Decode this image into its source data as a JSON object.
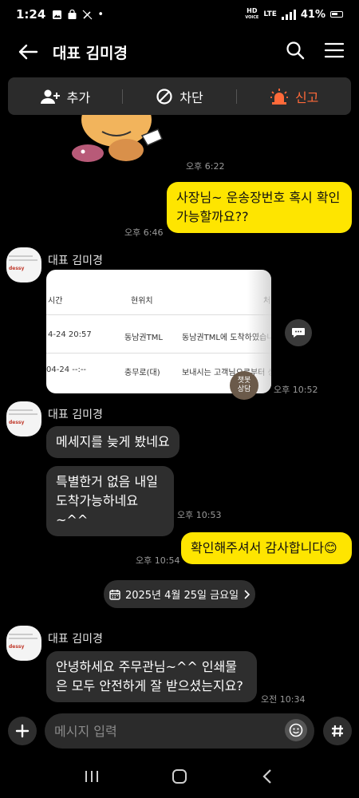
{
  "status_bar": {
    "time": "1:24",
    "network": "LTE",
    "hd_label": "HD",
    "voice_label": "VOICE",
    "battery": "41%"
  },
  "header": {
    "title": "대표 김미경"
  },
  "actions": {
    "add": "추가",
    "block": "차단",
    "report": "신고"
  },
  "messages": {
    "sticker_time": "오후 6:22",
    "msg1": "사장님~ 운송장번호 혹시 확인 가능할까요??",
    "msg1_time": "오후 6:46",
    "sender1": "대표 김미경",
    "image_time": "오후 10:52",
    "image_table": {
      "headers": [
        "시간",
        "현위치",
        "처"
      ],
      "rows": [
        [
          "4-24 20:57",
          "동남권TML",
          "동남권TML에 도착하였습니"
        ],
        [
          "04-24 --:--",
          "충무로(대)",
          "보내시는 고객님으로부터 상"
        ]
      ]
    },
    "chatbot_label": "챗봇\n상담",
    "sender2": "대표 김미경",
    "msg2": "메세지를 늦게 봤네요",
    "msg3": "특별한거 없음 내일 도착가능하네요~^^",
    "msg3_time": "오후 10:53",
    "msg4": "확인해주셔서 감사합니다😊",
    "msg4_time": "오후 10:54",
    "date_divider": "2025년 4월 25일 금요일",
    "sender3": "대표 김미경",
    "msg5": "안녕하세요 주무관님~^^ 인쇄물은 모두 안전하게 잘 받으셨는지요?",
    "msg5_time": "오전 10:34"
  },
  "input": {
    "placeholder": "메시지 입력"
  },
  "colors": {
    "my_bubble": "#fee500",
    "other_bubble": "#2e2e2e",
    "report_accent": "#ff6a3a",
    "background": "#000000"
  }
}
